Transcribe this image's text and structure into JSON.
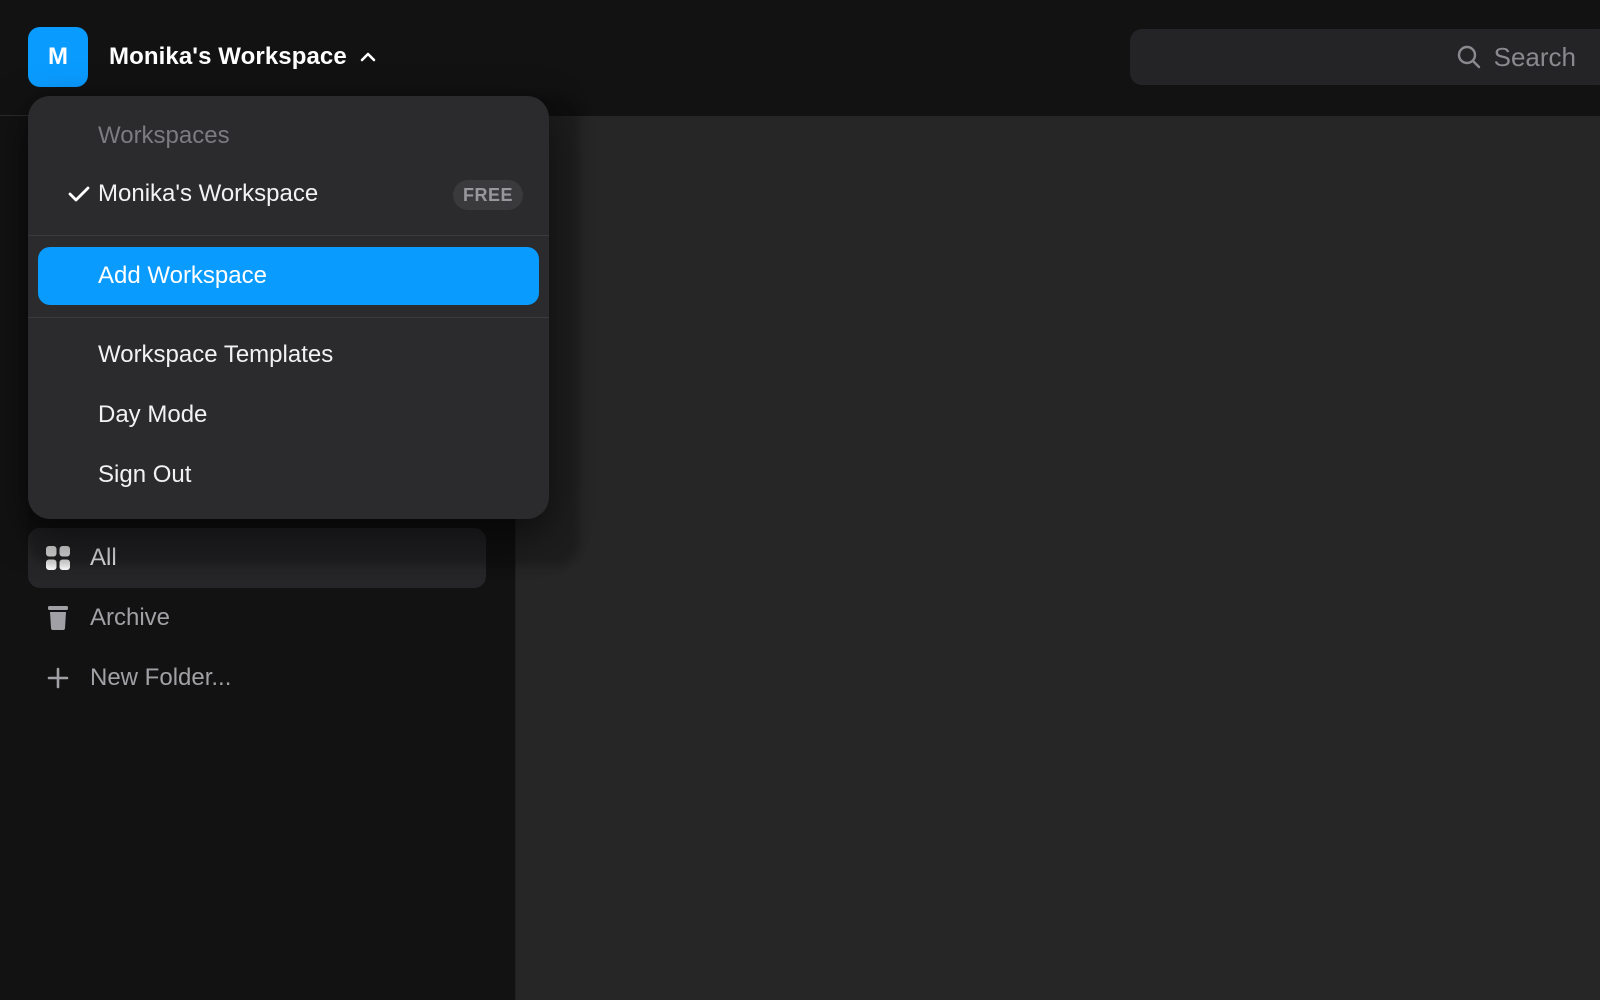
{
  "header": {
    "avatar_letter": "M",
    "workspace_name": "Monika's Workspace",
    "search_placeholder": "Search"
  },
  "dropdown": {
    "section_title": "Workspaces",
    "current_workspace": {
      "label": "Monika's Workspace",
      "badge": "FREE",
      "selected": true
    },
    "add_workspace": "Add Workspace",
    "items": [
      {
        "label": "Workspace Templates"
      },
      {
        "label": "Day Mode"
      },
      {
        "label": "Sign Out"
      }
    ]
  },
  "sidebar": {
    "items": [
      {
        "label": "All",
        "icon": "grid-icon",
        "active": true
      },
      {
        "label": "Archive",
        "icon": "trash-icon",
        "active": false
      },
      {
        "label": "New Folder...",
        "icon": "plus-icon",
        "active": false
      }
    ]
  },
  "colors": {
    "accent": "#0a9bff",
    "background": "#121213",
    "main_panel": "#262627",
    "menu": "#2b2b2d"
  }
}
